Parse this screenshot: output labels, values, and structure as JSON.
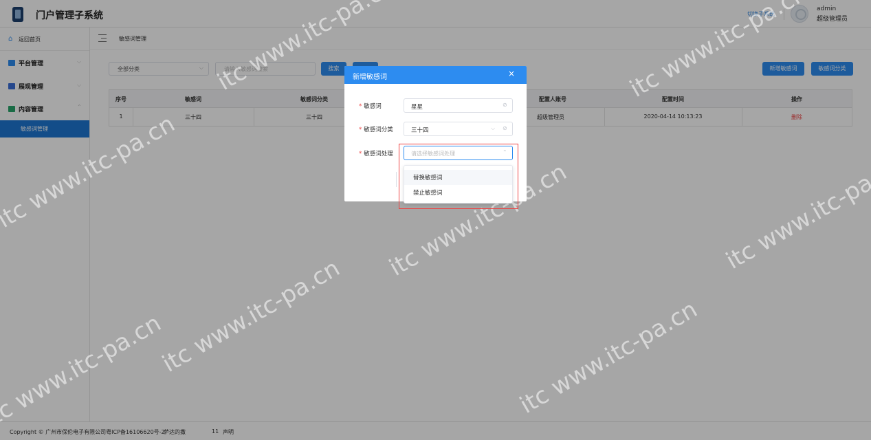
{
  "header": {
    "app_title": "门户管理子系统",
    "switch_link": "切换子系统",
    "user_name": "admin",
    "user_role": "超级管理员"
  },
  "sidebar": {
    "home": "返回首页",
    "items": [
      {
        "label": "平台管理",
        "icon_color": "#2d8cf0"
      },
      {
        "label": "展现管理",
        "icon_color": "#3a6ed8"
      },
      {
        "label": "内容管理",
        "icon_color": "#27a56a"
      }
    ],
    "sub_item": "敏感词管理"
  },
  "breadcrumb": {
    "current": "敏感词管理"
  },
  "filter": {
    "category_value": "全部分类",
    "search_placeholder": "请输入敏感词搜索",
    "search_button": "搜索",
    "add_button": "新增敏感词",
    "category_button": "敏感词分类"
  },
  "table": {
    "headers": [
      "序号",
      "敏感词",
      "敏感词分类",
      "配置人账号",
      "配置时间",
      "操作"
    ],
    "rows": [
      {
        "index": "1",
        "word": "三十四",
        "category": "三十四",
        "account": "超级管理员",
        "time": "2020-04-14 10:13:23",
        "action": "删除"
      }
    ]
  },
  "footer": {
    "copyright": "Copyright © 广州市保伦电子有限公司粤ICP备16106620号-2",
    "extra": "萨达的撒",
    "number": "11",
    "statement": "声明"
  },
  "modal": {
    "title": "新增敏感词",
    "close": "×",
    "fields": {
      "word_label": "敏感词",
      "word_value": "星星",
      "category_label": "敏感词分类",
      "category_value": "三十四",
      "handling_label": "敏感词处理",
      "handling_placeholder": "请选择敏感词处理"
    },
    "options": [
      "替换敏感词",
      "禁止敏感词"
    ]
  },
  "watermark": "itc www.itc-pa.cn",
  "colors": {
    "primary": "#2d8cf0",
    "sidebar_active": "#1e77d3",
    "danger": "#e44444"
  }
}
